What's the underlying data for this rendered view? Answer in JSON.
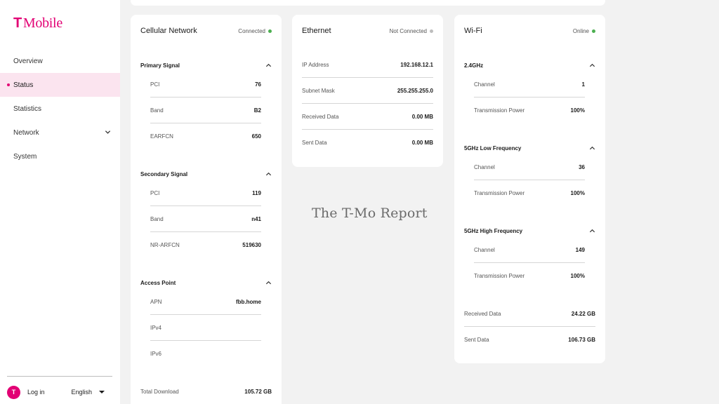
{
  "brand": {
    "glyph": "T",
    "name": "Mobile",
    "accent": "#e20074"
  },
  "sidebar": {
    "items": [
      {
        "label": "Overview"
      },
      {
        "label": "Status",
        "active": true
      },
      {
        "label": "Statistics"
      },
      {
        "label": "Network",
        "icon": "chevron-down-icon"
      },
      {
        "label": "System"
      }
    ],
    "login": {
      "avatar_glyph": "T",
      "label": "Log in"
    },
    "language": {
      "selected": "English"
    }
  },
  "cellular": {
    "title": "Cellular Network",
    "status": "Connected",
    "status_color": "#4caf50",
    "primary": {
      "title": "Primary Signal",
      "rows": [
        {
          "label": "PCI",
          "value": "76"
        },
        {
          "label": "Band",
          "value": "B2"
        },
        {
          "label": "EARFCN",
          "value": "650"
        }
      ]
    },
    "secondary": {
      "title": "Secondary Signal",
      "rows": [
        {
          "label": "PCI",
          "value": "119"
        },
        {
          "label": "Band",
          "value": "n41"
        },
        {
          "label": "NR-ARFCN",
          "value": "519630"
        }
      ]
    },
    "access_point": {
      "title": "Access Point",
      "rows": [
        {
          "label": "APN",
          "value": "fbb.home"
        },
        {
          "label": "IPv4",
          "value": ""
        },
        {
          "label": "IPv6",
          "value": ""
        }
      ]
    },
    "total_download": {
      "label": "Total Download",
      "value": "105.72 GB"
    }
  },
  "ethernet": {
    "title": "Ethernet",
    "status": "Not Connected",
    "status_color": "#bdbdbd",
    "rows": [
      {
        "label": "IP Address",
        "value": "192.168.12.1"
      },
      {
        "label": "Subnet Mask",
        "value": "255.255.255.0"
      },
      {
        "label": "Received Data",
        "value": "0.00 MB"
      },
      {
        "label": "Sent Data",
        "value": "0.00 MB"
      }
    ]
  },
  "wifi": {
    "title": "Wi-Fi",
    "status": "Online",
    "status_color": "#4caf50",
    "band_24": {
      "title": "2.4GHz",
      "rows": [
        {
          "label": "Channel",
          "value": "1"
        },
        {
          "label": "Transmission Power",
          "value": "100%"
        }
      ]
    },
    "band_5_low": {
      "title": "5GHz Low Frequency",
      "rows": [
        {
          "label": "Channel",
          "value": "36"
        },
        {
          "label": "Transmission Power",
          "value": "100%"
        }
      ]
    },
    "band_5_high": {
      "title": "5GHz High Frequency",
      "rows": [
        {
          "label": "Channel",
          "value": "149"
        },
        {
          "label": "Transmission Power",
          "value": "100%"
        }
      ]
    },
    "received": {
      "label": "Received Data",
      "value": "24.22 GB"
    },
    "sent": {
      "label": "Sent Data",
      "value": "106.73 GB"
    }
  },
  "watermark": "The T-Mo Report"
}
